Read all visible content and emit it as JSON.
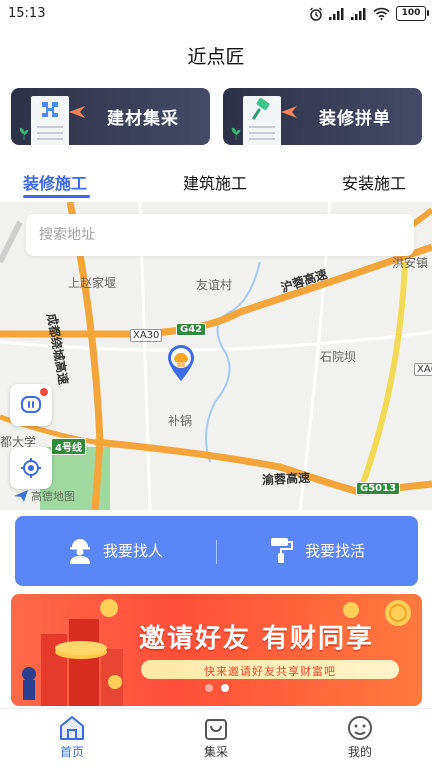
{
  "status_bar": {
    "time": "15:13",
    "battery": "100",
    "icons": [
      "alarm-icon",
      "signal-icon",
      "signal-icon",
      "wifi-icon",
      "battery-icon"
    ]
  },
  "app": {
    "title": "近点匠"
  },
  "feature_cards": [
    {
      "label": "建材集采",
      "icon": "material-icon"
    },
    {
      "label": "装修拼单",
      "icon": "brush-icon"
    }
  ],
  "tabs": [
    {
      "label": "装修施工",
      "active": true
    },
    {
      "label": "建筑施工",
      "active": false
    },
    {
      "label": "安装施工",
      "active": false
    }
  ],
  "search": {
    "placeholder": "搜索地址"
  },
  "map": {
    "labels": {
      "zhaojia": "上赵家堰",
      "youyi": "友谊村",
      "hongan": "洪安镇",
      "ring_road": "成都绕城高速",
      "hurong": "沪蓉高速",
      "shiyuan": "石院坝",
      "buguo": "补锅",
      "university": "都大学",
      "line4": "4号线",
      "yurong": "渝蓉高速",
      "xa30": "XA30",
      "g42": "G42",
      "xa_right": "XA0",
      "g5013": "G5013"
    },
    "watermark": "高德地图"
  },
  "actions": [
    {
      "label": "我要找人",
      "icon": "worker-icon"
    },
    {
      "label": "我要找活",
      "icon": "paint-roller-icon"
    }
  ],
  "banner": {
    "title": "邀请好友 有财同享",
    "subtitle": "快来邀请好友共享财富吧",
    "active_slide": 1,
    "slide_count": 2
  },
  "bottom_nav": [
    {
      "label": "首页",
      "icon": "home-icon",
      "active": true
    },
    {
      "label": "集采",
      "icon": "bag-icon",
      "active": false
    },
    {
      "label": "我的",
      "icon": "profile-icon",
      "active": false
    }
  ],
  "colors": {
    "accent": "#3d6be8",
    "action_bar": "#5b87f6",
    "card_dark": "#2d3146",
    "banner": "#ff4e3a",
    "road_orange": "#f7a33a",
    "road_yellow": "#f6e05a"
  }
}
